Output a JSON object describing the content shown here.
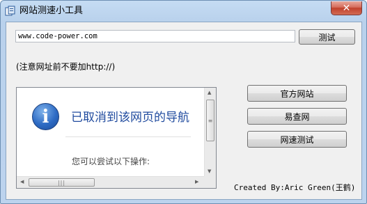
{
  "window": {
    "title": "网站测速小工具",
    "close_label": "✕"
  },
  "url_field": {
    "value": "www.code-power.com"
  },
  "buttons": {
    "test": "测试",
    "official": "官方网站",
    "lookup": "易查网",
    "speed": "网速测试"
  },
  "hint": "(注意网址前不要加http://)",
  "browser": {
    "heading": "已取消到该网页的导航",
    "suggestion": "您可以尝试以下操作:",
    "icon": "info-icon"
  },
  "credit": "Created By:Aric Green(王鹤)"
}
